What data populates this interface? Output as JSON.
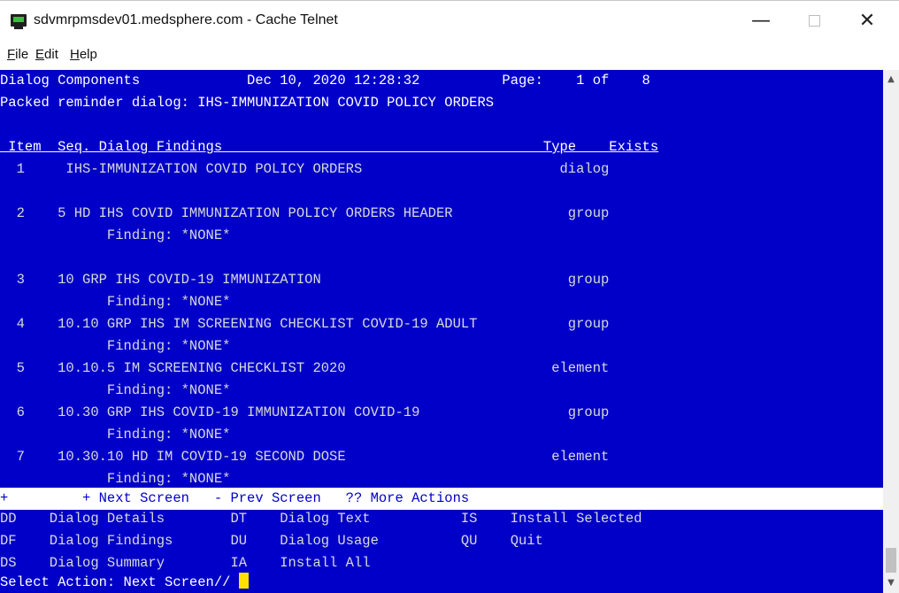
{
  "window": {
    "title": "sdvmrpmsdev01.medsphere.com - Cache Telnet",
    "minimize": "—",
    "close": "✕"
  },
  "menu": {
    "items": [
      {
        "accel": "F",
        "rest": "ile"
      },
      {
        "accel": "E",
        "rest": "dit"
      },
      {
        "accel": "H",
        "rest": "elp"
      }
    ]
  },
  "terminal": {
    "header": "Dialog Components             Dec 10, 2020 12:28:32          Page:    1 of    8",
    "subtitle": "Packed reminder dialog: IHS-IMMUNIZATION COVID POLICY ORDERS",
    "columns": " Item  Seq. Dialog Findings                                       Type    Exists",
    "rows": [
      "  1     IHS-IMMUNIZATION COVID POLICY ORDERS                        dialog",
      "",
      "  2    5 HD IHS COVID IMMUNIZATION POLICY ORDERS HEADER              group",
      "             Finding: *NONE*",
      "",
      "",
      "  3    10 GRP IHS COVID-19 IMMUNIZATION                              group",
      "             Finding: *NONE*",
      "  4    10.10 GRP IHS IM SCREENING CHECKLIST COVID-19 ADULT           group",
      "             Finding: *NONE*",
      "  5    10.10.5 IM SCREENING CHECKLIST 2020                         element",
      "             Finding: *NONE*",
      "  6    10.30 GRP IHS COVID-19 IMMUNIZATION COVID-19                  group",
      "             Finding: *NONE*",
      "  7    10.30.10 HD IM COVID-19 SECOND DOSE                         element",
      "             Finding: *NONE*"
    ],
    "nav_bar": "+         + Next Screen   - Prev Screen   ?? More Actions",
    "actions": [
      "DD    Dialog Details        DT    Dialog Text           IS    Install Selected",
      "DF    Dialog Findings       DU    Dialog Usage          QU    Quit",
      "DS    Dialog Summary        IA    Install All"
    ],
    "prompt": "Select Action: Next Screen// "
  },
  "scrollbar": {
    "up": "▲",
    "down": "▼"
  }
}
